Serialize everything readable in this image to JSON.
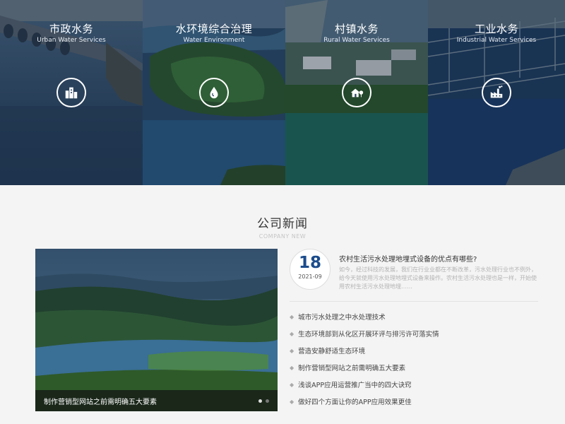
{
  "services": [
    {
      "title": "市政水务",
      "subtitle": "Urban Water Services",
      "icon": "city-buildings-icon"
    },
    {
      "title": "水环境综合治理",
      "subtitle": "Water Environment",
      "icon": "water-drop-icon"
    },
    {
      "title": "村镇水务",
      "subtitle": "Rural Water Services",
      "icon": "house-tree-icon"
    },
    {
      "title": "工业水务",
      "subtitle": "Industrial Water Services",
      "icon": "factory-icon"
    }
  ],
  "news_section": {
    "title": "公司新闻",
    "subtitle": "COMPANY NEW"
  },
  "feature": {
    "caption": "制作营销型网站之前需明确五大要素",
    "slide_count": 2,
    "active_slide": 1
  },
  "top_news": {
    "day": "18",
    "year_month": "2021-09",
    "title": "农村生活污水处理地埋式设备的优点有哪些?",
    "summary": "如今，经过科技的发展，我们在行业业都在不断改革，污水处理行业也不例外，给今天就使用污水处理地埋式设备来操作。农村生活污水处理也是一样，开始使用农村生活污水处理地埋……"
  },
  "news_items": [
    "城市污水处理之中水处理技术",
    "生态环境部到从化区开展环评与排污许可落实情",
    "营造安静舒适生态环境",
    "制作营销型网站之前需明确五大要素",
    "浅谈APP应用运营推广当中的四大诀窍",
    "做好四个方面让你的APP应用效果更佳"
  ],
  "colors": {
    "accent": "#1b4c8c",
    "page_bg": "#f4f4f4"
  }
}
